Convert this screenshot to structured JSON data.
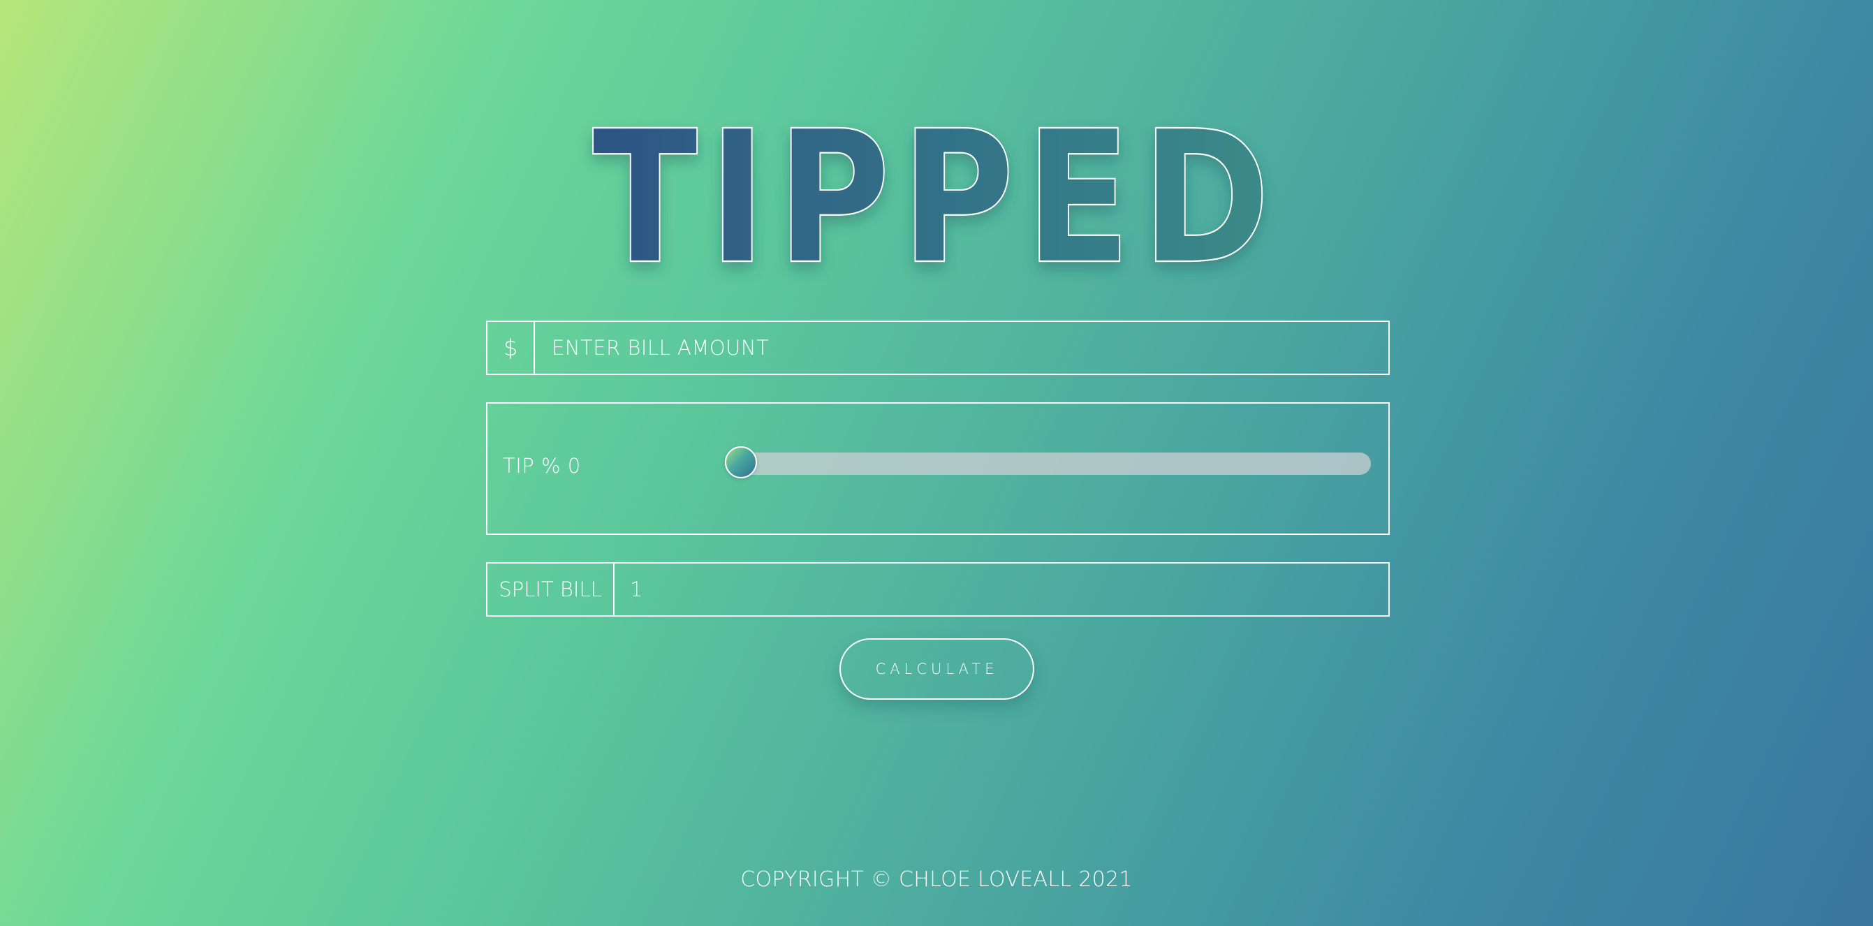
{
  "header": {
    "logo_text": "TIPPED"
  },
  "bill": {
    "currency_symbol": "$",
    "placeholder": "ENTER BILL AMOUNT",
    "value": ""
  },
  "tip": {
    "label": "TIP %",
    "value": "0",
    "slider_fraction": 0
  },
  "split": {
    "label": "SPLIT BILL",
    "value": "1"
  },
  "actions": {
    "calculate_label": "CALCULATE"
  },
  "footer": {
    "copyright": "COPYRIGHT © CHLOE LOVEALL 2021"
  },
  "colors": {
    "gradient_start": "#b6e67a",
    "gradient_end": "#3a779e",
    "logo_fill_dark": "#2f5a84",
    "logo_fill_light": "#3b8a8a",
    "border": "#ffffff"
  }
}
